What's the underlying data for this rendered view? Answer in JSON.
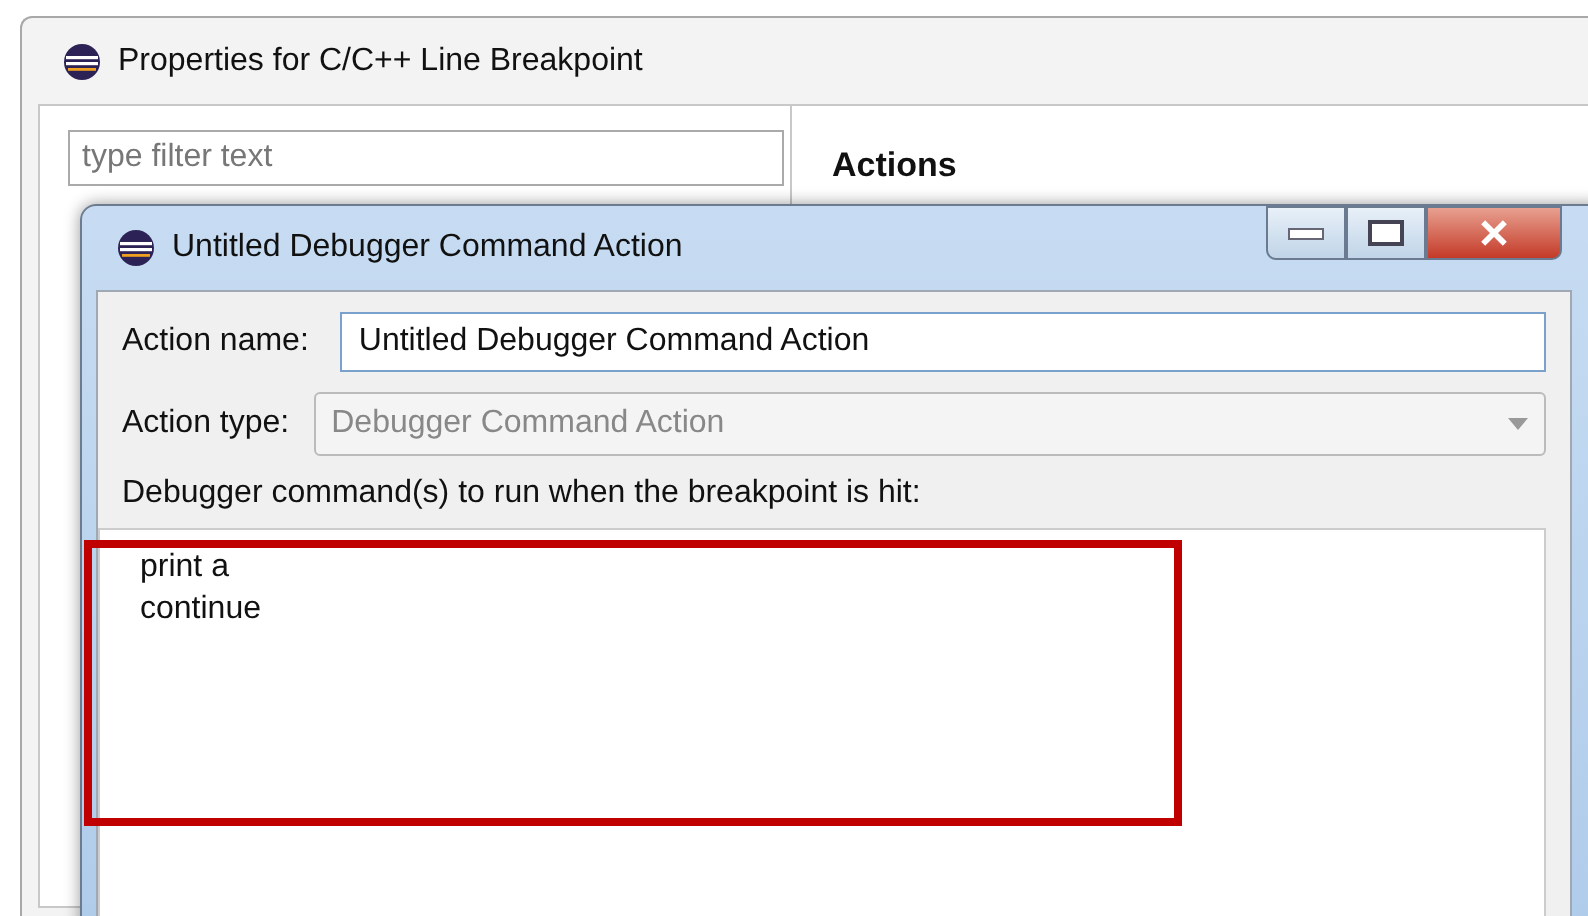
{
  "window": {
    "title": "Properties for C/C++ Line Breakpoint"
  },
  "filter": {
    "placeholder": "type filter text"
  },
  "page_title": "Actions",
  "dialog": {
    "title": "Untitled Debugger Command Action",
    "fields": [
      {
        "kind": "text",
        "label": "Action name:",
        "value": "Untitled Debugger Command Action",
        "disabled": false
      },
      {
        "kind": "combo",
        "label": "Action type:",
        "value": "Debugger Command Action",
        "disabled": true
      }
    ],
    "commands_label": "Debugger command(s) to run when the breakpoint is hit:",
    "commands": [
      "print a",
      "continue"
    ]
  }
}
